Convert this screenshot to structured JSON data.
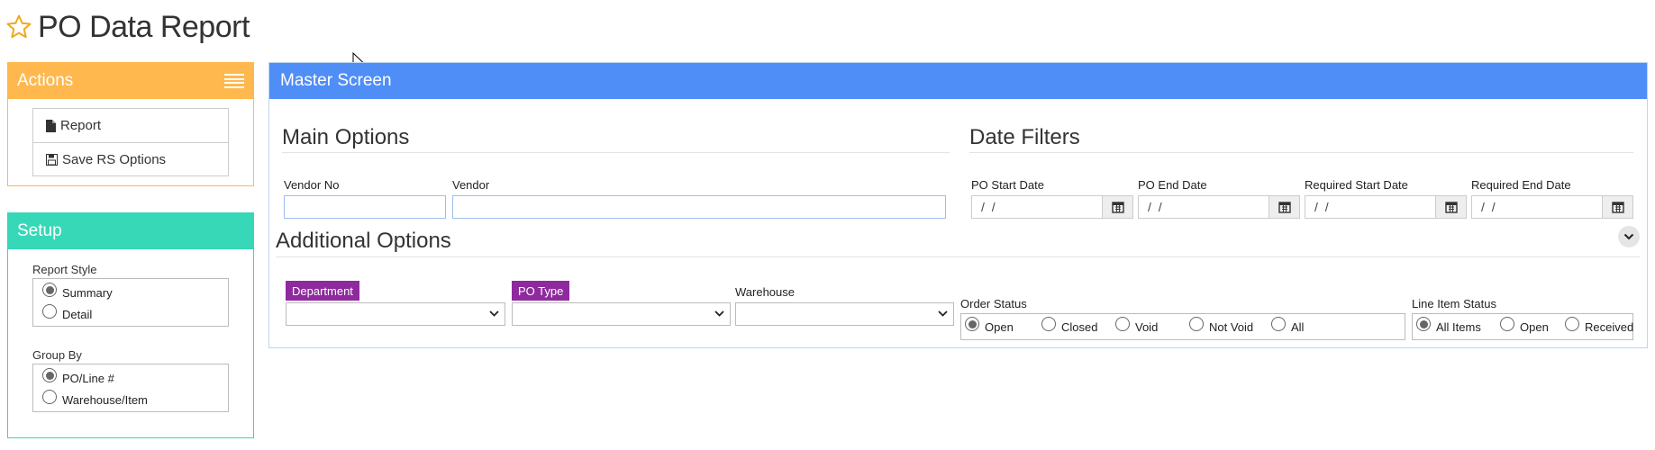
{
  "page": {
    "title": "PO Data Report"
  },
  "actions": {
    "title": "Actions",
    "items": [
      {
        "label": "Report",
        "icon": "file-icon"
      },
      {
        "label": "Save RS Options",
        "icon": "save-icon"
      }
    ]
  },
  "setup": {
    "title": "Setup",
    "report_style": {
      "label": "Report Style",
      "options": [
        "Summary",
        "Detail"
      ],
      "selected": "Summary"
    },
    "group_by": {
      "label": "Group By",
      "options": [
        "PO/Line #",
        "Warehouse/Item"
      ],
      "selected": "PO/Line #"
    }
  },
  "master": {
    "title": "Master Screen",
    "main_options": {
      "title": "Main Options",
      "vendor_no_label": "Vendor No",
      "vendor_no_value": "",
      "vendor_label": "Vendor",
      "vendor_value": ""
    },
    "date_filters": {
      "title": "Date Filters",
      "po_start_label": "PO Start Date",
      "po_start_value": "/ /",
      "po_end_label": "PO End Date",
      "po_end_value": "/ /",
      "req_start_label": "Required Start Date",
      "req_start_value": "/ /",
      "req_end_label": "Required End Date",
      "req_end_value": "/ /"
    },
    "additional_options": {
      "title": "Additional Options",
      "department_label": "Department",
      "po_type_label": "PO Type",
      "warehouse_label": "Warehouse",
      "order_status": {
        "label": "Order Status",
        "options": [
          "Open",
          "Closed",
          "Void",
          "Not Void",
          "All"
        ],
        "selected": "Open"
      },
      "line_item_status": {
        "label": "Line Item Status",
        "options": [
          "All Items",
          "Open",
          "Received"
        ],
        "selected": "All Items"
      }
    }
  },
  "colors": {
    "actions_accent": "#ffb84d",
    "setup_accent": "#36d8b8",
    "master_accent": "#4f8ef7",
    "tag_purple": "#8e2a9e"
  }
}
